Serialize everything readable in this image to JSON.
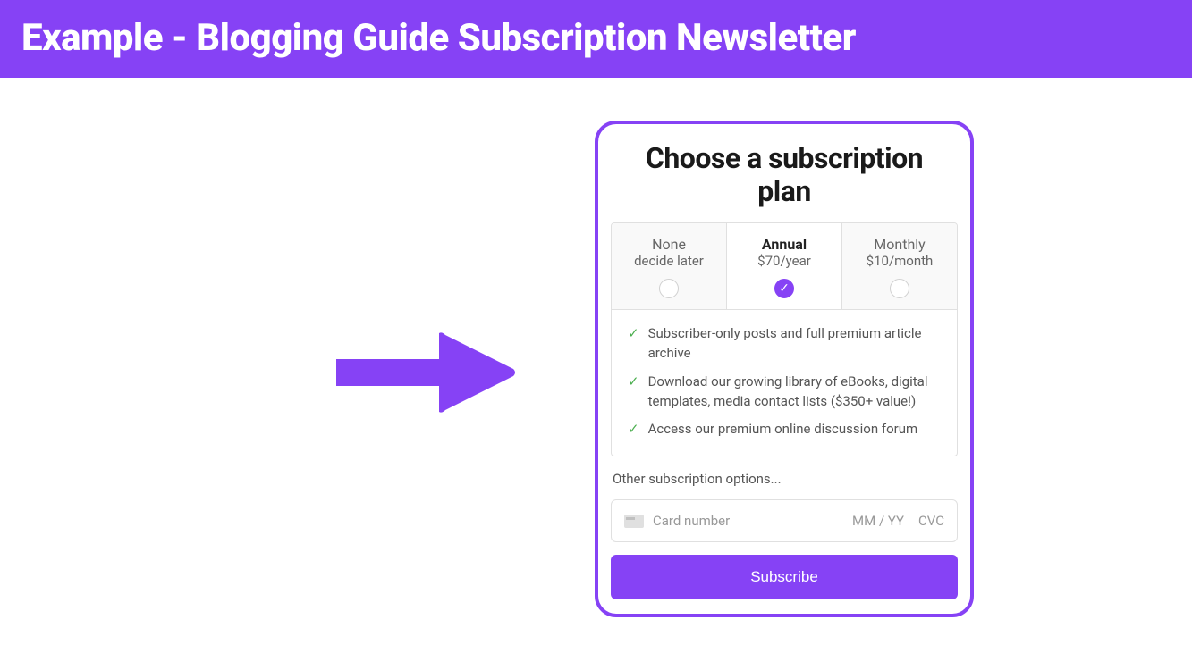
{
  "header": {
    "title": "Example - Blogging Guide Subscription Newsletter"
  },
  "card": {
    "title": "Choose a subscription plan",
    "plans": [
      {
        "name": "None",
        "price": "decide later",
        "selected": false
      },
      {
        "name": "Annual",
        "price": "$70/year",
        "selected": true
      },
      {
        "name": "Monthly",
        "price": "$10/month",
        "selected": false
      }
    ],
    "features": [
      "Subscriber-only posts and full premium article archive",
      "Download our growing library of eBooks, digital templates, media contact lists ($350+ value!)",
      "Access our premium online discussion forum"
    ],
    "other_options_label": "Other subscription options...",
    "payment": {
      "card_number_placeholder": "Card number",
      "expiry_placeholder": "MM / YY",
      "cvc_placeholder": "CVC"
    },
    "subscribe_label": "Subscribe"
  }
}
